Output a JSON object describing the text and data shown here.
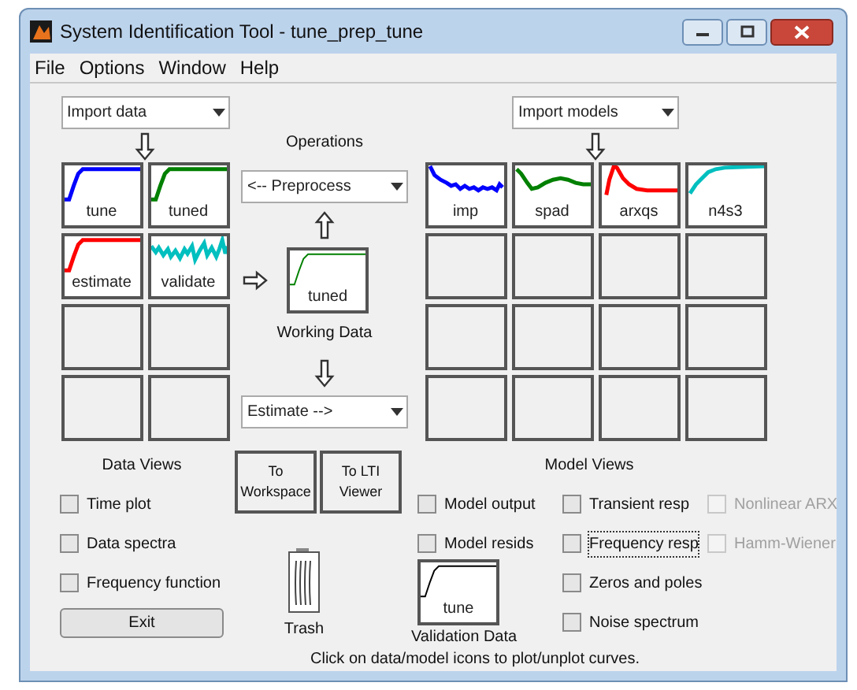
{
  "window": {
    "title": "System Identification Tool - tune_prep_tune"
  },
  "menu": [
    "File",
    "Options",
    "Window",
    "Help"
  ],
  "data_import": {
    "value": "Import data"
  },
  "model_import": {
    "value": "Import models"
  },
  "operations": {
    "label": "Operations",
    "preprocess": "<-- Preprocess",
    "estimate": "Estimate -->",
    "working_data": {
      "label": "tuned",
      "kind": "step",
      "color": "#008000"
    },
    "working_label": "Working Data"
  },
  "data_tiles": [
    {
      "kind": "step",
      "label": "tune",
      "color": "#0000ff"
    },
    {
      "kind": "step",
      "label": "tuned",
      "color": "#008000"
    },
    {
      "kind": "step",
      "label": "estimate",
      "color": "#ff0000"
    },
    {
      "kind": "noisy",
      "label": "validate",
      "color": "#00bfbf"
    },
    {
      "kind": "empty"
    },
    {
      "kind": "empty"
    },
    {
      "kind": "empty"
    },
    {
      "kind": "empty"
    }
  ],
  "model_tiles": [
    {
      "kind": "decay",
      "label": "imp",
      "color": "#0000ff"
    },
    {
      "kind": "dip",
      "label": "spad",
      "color": "#008000"
    },
    {
      "kind": "peak",
      "label": "arxqs",
      "color": "#ff0000"
    },
    {
      "kind": "rise",
      "label": "n4s3",
      "color": "#00bfbf"
    },
    {
      "kind": "empty"
    },
    {
      "kind": "empty"
    },
    {
      "kind": "empty"
    },
    {
      "kind": "empty"
    },
    {
      "kind": "empty"
    },
    {
      "kind": "empty"
    },
    {
      "kind": "empty"
    },
    {
      "kind": "empty"
    },
    {
      "kind": "empty"
    },
    {
      "kind": "empty"
    },
    {
      "kind": "empty"
    },
    {
      "kind": "empty"
    }
  ],
  "data_views": {
    "title": "Data Views",
    "options": [
      {
        "label": "Time plot",
        "checked": false
      },
      {
        "label": "Data spectra",
        "checked": false
      },
      {
        "label": "Frequency function",
        "checked": false
      }
    ]
  },
  "exit_button": "Exit",
  "export_buttons": [
    "To Workspace",
    "To LTI Viewer"
  ],
  "trash": {
    "label": "Trash"
  },
  "validation": {
    "tile": {
      "label": "tune",
      "kind": "step",
      "color": "#000000"
    },
    "label": "Validation Data"
  },
  "model_views": {
    "title": "Model Views",
    "columns": [
      [
        {
          "label": "Model output",
          "checked": false,
          "disabled": false,
          "focused": false
        },
        {
          "label": "Model resids",
          "checked": false,
          "disabled": false,
          "focused": false
        }
      ],
      [
        {
          "label": "Transient resp",
          "checked": false,
          "disabled": false,
          "focused": false
        },
        {
          "label": "Frequency resp",
          "checked": false,
          "disabled": false,
          "focused": true
        },
        {
          "label": "Zeros and poles",
          "checked": false,
          "disabled": false,
          "focused": false
        },
        {
          "label": "Noise spectrum",
          "checked": false,
          "disabled": false,
          "focused": false
        }
      ],
      [
        {
          "label": "Nonlinear ARX",
          "checked": false,
          "disabled": true,
          "focused": false
        },
        {
          "label": "Hamm-Wiener",
          "checked": false,
          "disabled": true,
          "focused": false
        }
      ]
    ]
  },
  "hint": "Click on data/model icons to plot/unplot curves."
}
